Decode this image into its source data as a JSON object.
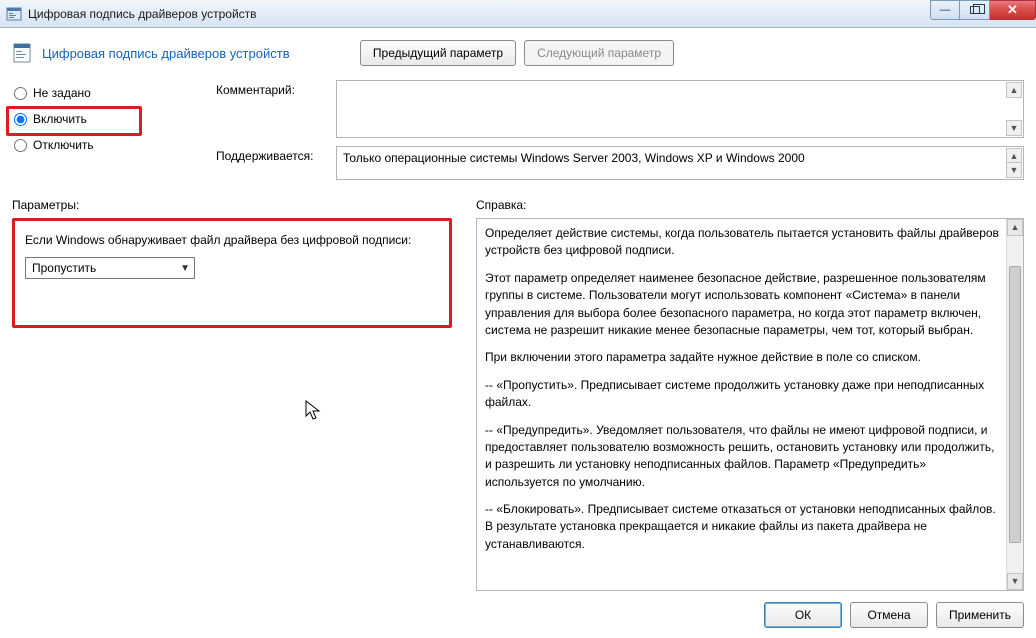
{
  "window": {
    "title": "Цифровая подпись драйверов устройств"
  },
  "header": {
    "title": "Цифровая подпись драйверов устройств",
    "prev_button": "Предыдущий параметр",
    "next_button": "Следующий параметр"
  },
  "radios": {
    "not_configured": "Не задано",
    "enabled": "Включить",
    "disabled": "Отключить",
    "selected": "enabled"
  },
  "labels": {
    "comment": "Комментарий:",
    "supported": "Поддерживается:",
    "parameters": "Параметры:",
    "help": "Справка:"
  },
  "supported_text": "Только операционные системы Windows Server 2003, Windows XP и Windows 2000",
  "params": {
    "prompt": "Если Windows обнаруживает файл драйвера без цифровой подписи:",
    "combo_value": "Пропустить"
  },
  "help": {
    "p1": "Определяет действие системы, когда пользователь пытается установить файлы драйверов устройств без цифровой подписи.",
    "p2": "Этот параметр определяет наименее безопасное действие, разрешенное пользователям группы в системе. Пользователи могут использовать компонент «Система» в панели управления для выбора более безопасного параметра, но когда этот параметр включен, система не разрешит никакие менее безопасные параметры, чем тот, который выбран.",
    "p3": "При включении этого параметра задайте нужное действие в поле со списком.",
    "p4": "--   «Пропустить». Предписывает системе продолжить установку даже при неподписанных файлах.",
    "p5": "--   «Предупредить». Уведомляет пользователя, что файлы не имеют цифровой подписи, и предоставляет пользователю возможность решить, остановить установку или продолжить, и разрешить ли установку неподписанных файлов. Параметр «Предупредить» используется по умолчанию.",
    "p6": "--   «Блокировать». Предписывает системе отказаться от установки неподписанных файлов. В результате установка прекращается и никакие файлы из пакета драйвера не устанавливаются."
  },
  "footer": {
    "ok": "ОК",
    "cancel": "Отмена",
    "apply": "Применить"
  }
}
